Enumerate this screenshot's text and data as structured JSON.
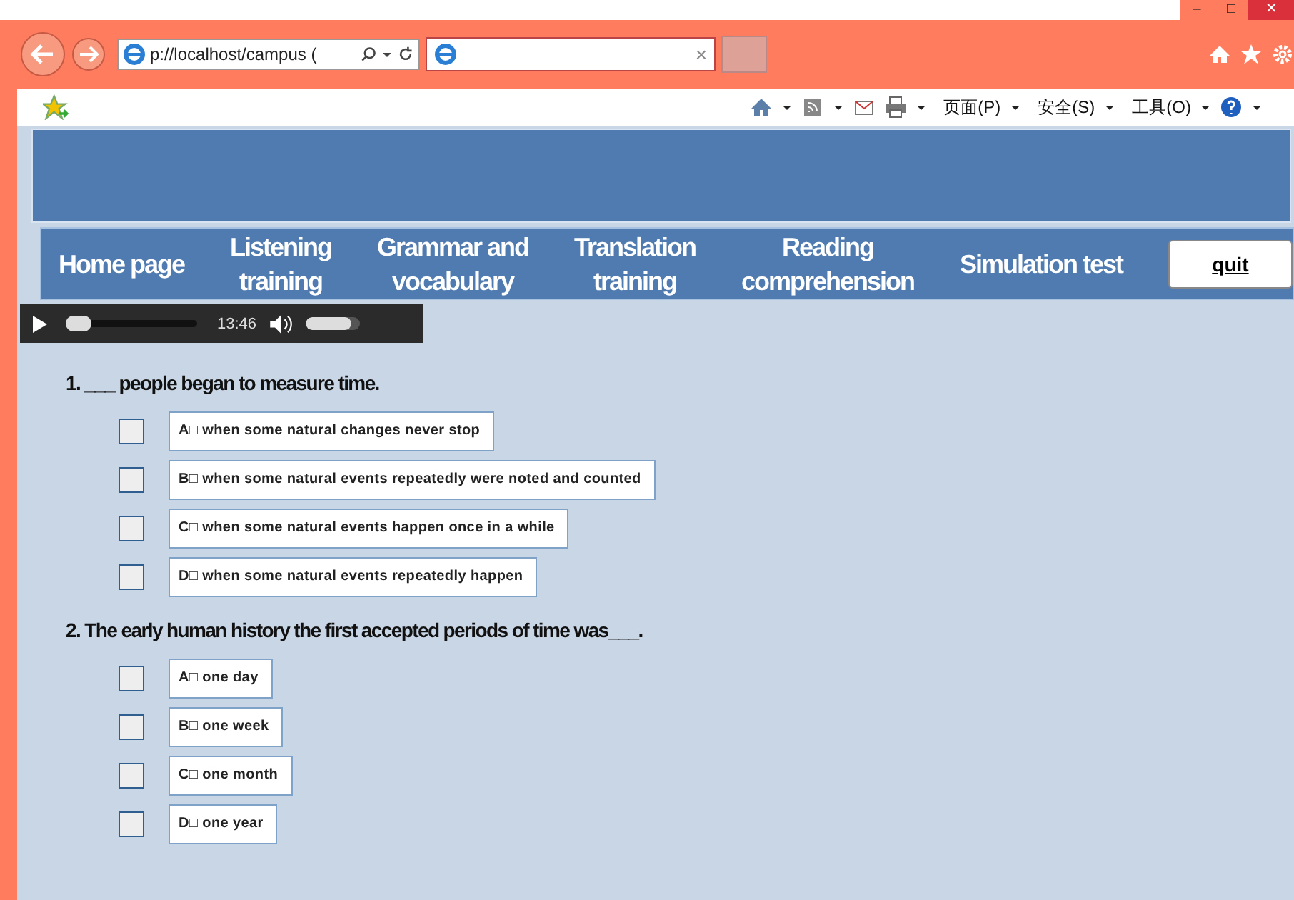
{
  "browser": {
    "address": "p://localhost/campus (",
    "tab_close": "×",
    "window_controls": [
      "–",
      "□",
      "✕"
    ],
    "menus": [
      "页面(P)",
      "安全(S)",
      "工具(O)"
    ]
  },
  "nav": {
    "items": [
      {
        "label": "Home page"
      },
      {
        "label": "Listening\ntraining"
      },
      {
        "label": "Grammar and\nvocabulary"
      },
      {
        "label": "Translation\ntraining"
      },
      {
        "label": "Reading\ncomprehension"
      },
      {
        "label": "Simulation test"
      }
    ],
    "quit": "quit"
  },
  "player": {
    "progress": {
      "level": 0.05
    },
    "time": "13:46",
    "volume": {
      "level": 0.85
    }
  },
  "questions": [
    {
      "text": "1. ___  people began to measure time.",
      "options": [
        {
          "text": "A□ when some natural changes never stop",
          "checked": false
        },
        {
          "text": "B□ when some natural events repeatedly were noted and counted",
          "checked": false
        },
        {
          "text": "C□ when some natural events happen once in a while",
          "checked": false
        },
        {
          "text": "D□ when some natural events repeatedly happen",
          "checked": false
        }
      ]
    },
    {
      "text": "2. The early human history the first accepted periods of time was___.",
      "options": [
        {
          "text": "A□ one day",
          "checked": false
        },
        {
          "text": "B□ one week",
          "checked": false
        },
        {
          "text": "C□ one month",
          "checked": false
        },
        {
          "text": "D□ one year",
          "checked": false
        }
      ]
    }
  ]
}
